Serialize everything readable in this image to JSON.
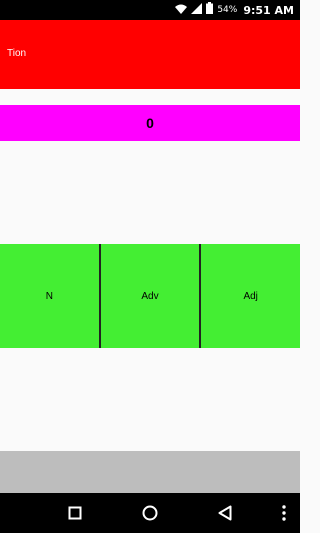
{
  "status_bar": {
    "battery_percent": "54%",
    "time": "9:51 AM",
    "icons": [
      "wifi-icon",
      "cell-signal-icon",
      "battery-icon"
    ]
  },
  "toolbar": {
    "title": "Tion",
    "color": "#ff0000"
  },
  "counter": {
    "value": "0",
    "color": "#ff00ff"
  },
  "word_buttons": [
    {
      "label": "N"
    },
    {
      "label": "Adv"
    },
    {
      "label": "Adj"
    }
  ],
  "colors": {
    "button_green": "#44ee33",
    "bottom_bar": "#bdbdbd"
  },
  "nav_bar": {
    "icons": [
      "recents-icon",
      "home-icon",
      "back-icon",
      "more-icon"
    ]
  }
}
